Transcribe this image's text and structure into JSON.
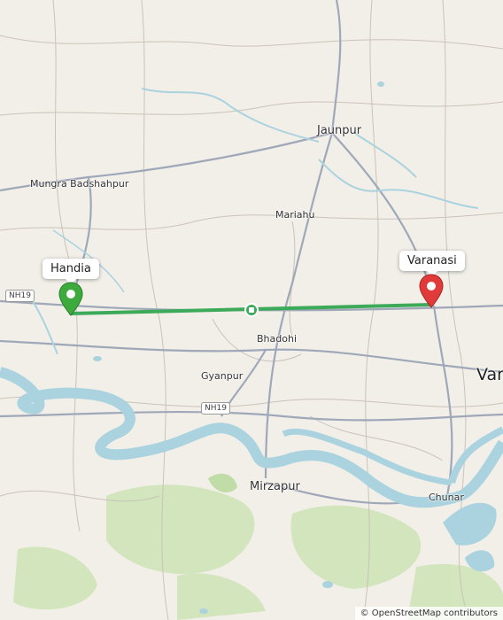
{
  "map": {
    "route_color": "#3daa5a",
    "origin_pin_color": "#3daa3d",
    "destination_pin_color": "#e03a3a",
    "water_color": "#aad3df",
    "land_color": "#f2efe9",
    "forest_color": "#cfe4b9"
  },
  "markers": {
    "origin_label": "Handia",
    "destination_label": "Varanasi"
  },
  "places": {
    "jaunpur": "Jaunpur",
    "mungra": "Mungra Badshahpur",
    "mariahu": "Mariahu",
    "bhadohi": "Bhadohi",
    "gyanpur": "Gyanpur",
    "mirzapur": "Mirzapur",
    "chunar": "Chunar",
    "varanasi_city": "Vara"
  },
  "roads": {
    "nh19_west": "NH19",
    "nh19_mid": "NH19"
  },
  "attribution": "© OpenStreetMap contributors"
}
